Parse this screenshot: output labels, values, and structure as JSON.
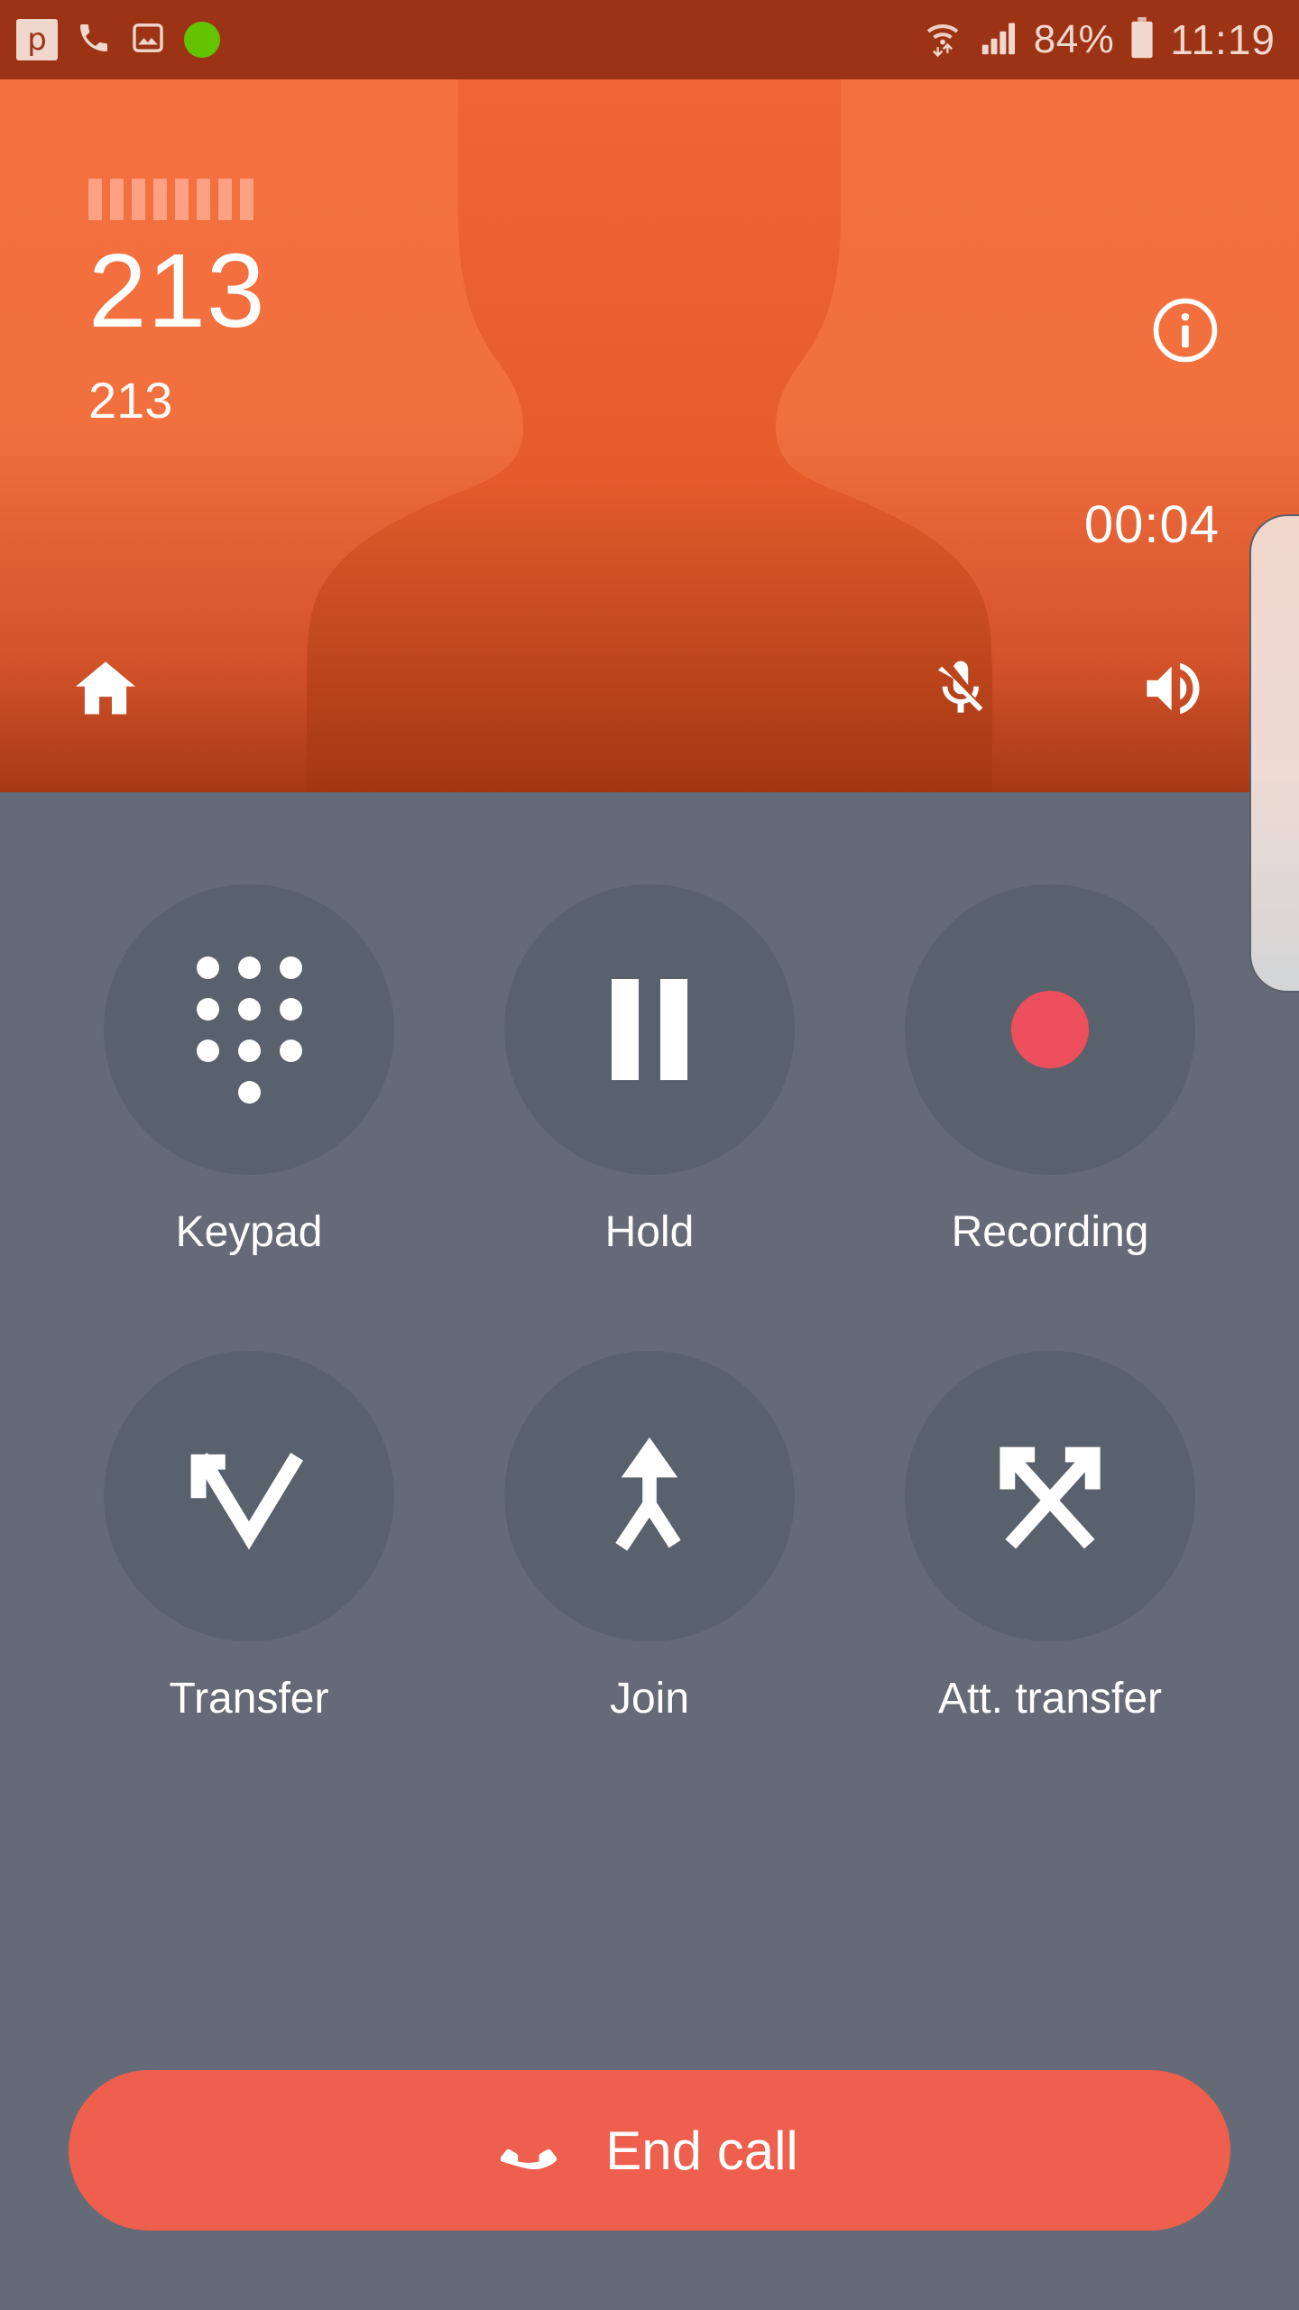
{
  "status_bar": {
    "left_icons": [
      {
        "name": "app-p-icon",
        "glyph": "p"
      },
      {
        "name": "call-icon",
        "glyph": "phone"
      },
      {
        "name": "gallery-icon",
        "glyph": "image"
      },
      {
        "name": "green-status-dot",
        "glyph": "circle"
      }
    ],
    "wifi_icon": "wifi-data-transfer-icon",
    "signal_icon": "signal-bars-icon",
    "battery_percent": "84%",
    "battery_icon": "battery-icon",
    "clock": "11:19",
    "background_color": "#9c3315",
    "text_color": "#f0d8ce"
  },
  "caller": {
    "name_redacted_bars": 8,
    "number_large": "213",
    "number_sub": "213",
    "duration": "00:04",
    "info_button_label": "i",
    "header_color_top": "#f4703f",
    "header_color_bottom": "#a63914"
  },
  "header_actions": [
    {
      "name": "home-button",
      "icon": "home-icon",
      "state": "default"
    },
    {
      "name": "mute-button",
      "icon": "microphone-muted-icon",
      "state": "muted"
    },
    {
      "name": "speaker-button",
      "icon": "speaker-icon",
      "state": "default"
    }
  ],
  "controls": {
    "row1": [
      {
        "label": "Keypad",
        "icon": "dialpad-icon"
      },
      {
        "label": "Hold",
        "icon": "pause-icon"
      },
      {
        "label": "Recording",
        "icon": "record-icon",
        "accent": "#ed4f5d"
      }
    ],
    "row2": [
      {
        "label": "Transfer",
        "icon": "call-transfer-icon"
      },
      {
        "label": "Join",
        "icon": "call-merge-icon"
      },
      {
        "label": "Att. transfer",
        "icon": "call-attended-transfer-icon"
      }
    ],
    "circle_color": "#59616c",
    "label_color": "#ffffff"
  },
  "end_call": {
    "label": "End call",
    "icon": "call-end-icon",
    "color": "#ee5f4d"
  },
  "edge_panel": {
    "name": "edge-panel-handle"
  }
}
